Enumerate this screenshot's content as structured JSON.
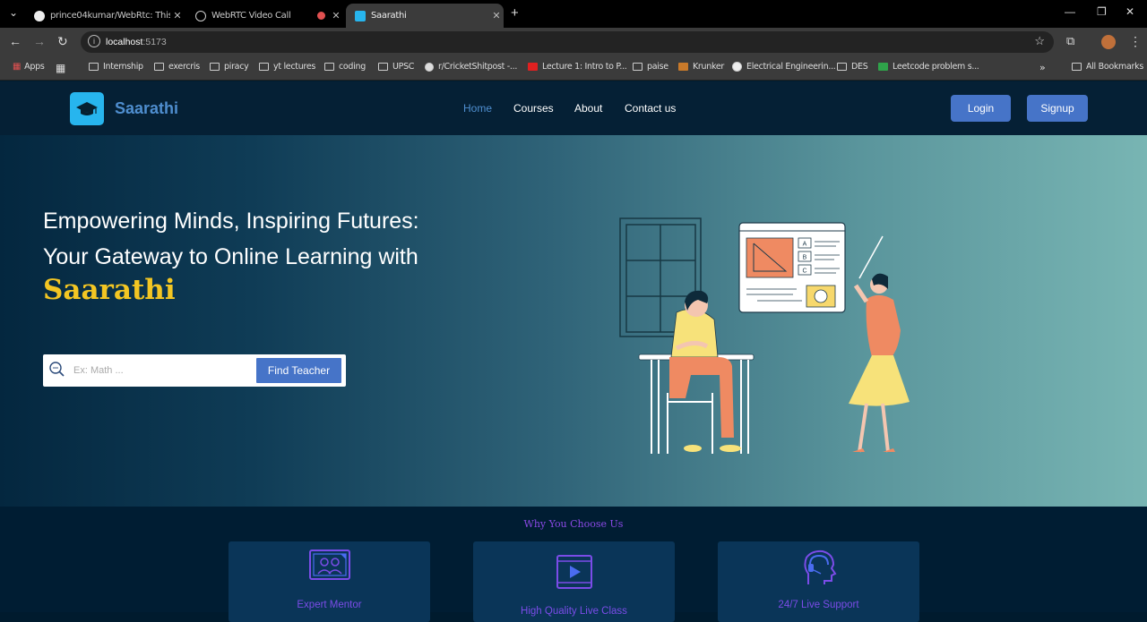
{
  "browser": {
    "tabs": [
      {
        "title": "prince04kumar/WebRtc: This is",
        "active": false
      },
      {
        "title": "WebRTC Video Call",
        "active": false
      },
      {
        "title": "Saarathi",
        "active": true
      }
    ],
    "url": "localhost",
    "port": ":5173",
    "bookmarks": [
      "Apps",
      "Internship",
      "exercris",
      "piracy",
      "yt lectures",
      "coding",
      "UPSC",
      "r/CricketShitpost -...",
      "Lecture 1: Intro to P...",
      "paise",
      "Krunker",
      "Electrical Engineerin...",
      "DES",
      "Leetcode problem s..."
    ],
    "all_bookmarks": "All Bookmarks"
  },
  "site": {
    "brand": "Saarathi",
    "nav": [
      "Home",
      "Courses",
      "About",
      "Contact us"
    ],
    "login": "Login",
    "signup": "Signup"
  },
  "hero": {
    "line1": "Empowering Minds, Inspiring Futures:",
    "line2": "Your Gateway to Online Learning with",
    "brand": "Saarathi",
    "search_placeholder": "Ex: Math ...",
    "search_button": "Find Teacher",
    "board_options": [
      "A",
      "B",
      "C"
    ]
  },
  "why": {
    "title": "Why You Choose Us",
    "cards": [
      {
        "label": "Expert Mentor",
        "icon": "mentor-icon"
      },
      {
        "label": "High Quality Live Class",
        "icon": "video-play-icon"
      },
      {
        "label": "24/7 Live Support",
        "icon": "headset-icon"
      }
    ]
  },
  "colors": {
    "accent": "#4674c8",
    "brand_text": "#4f8ecf",
    "highlight": "#f3c623",
    "purple": "#8a49e6"
  }
}
